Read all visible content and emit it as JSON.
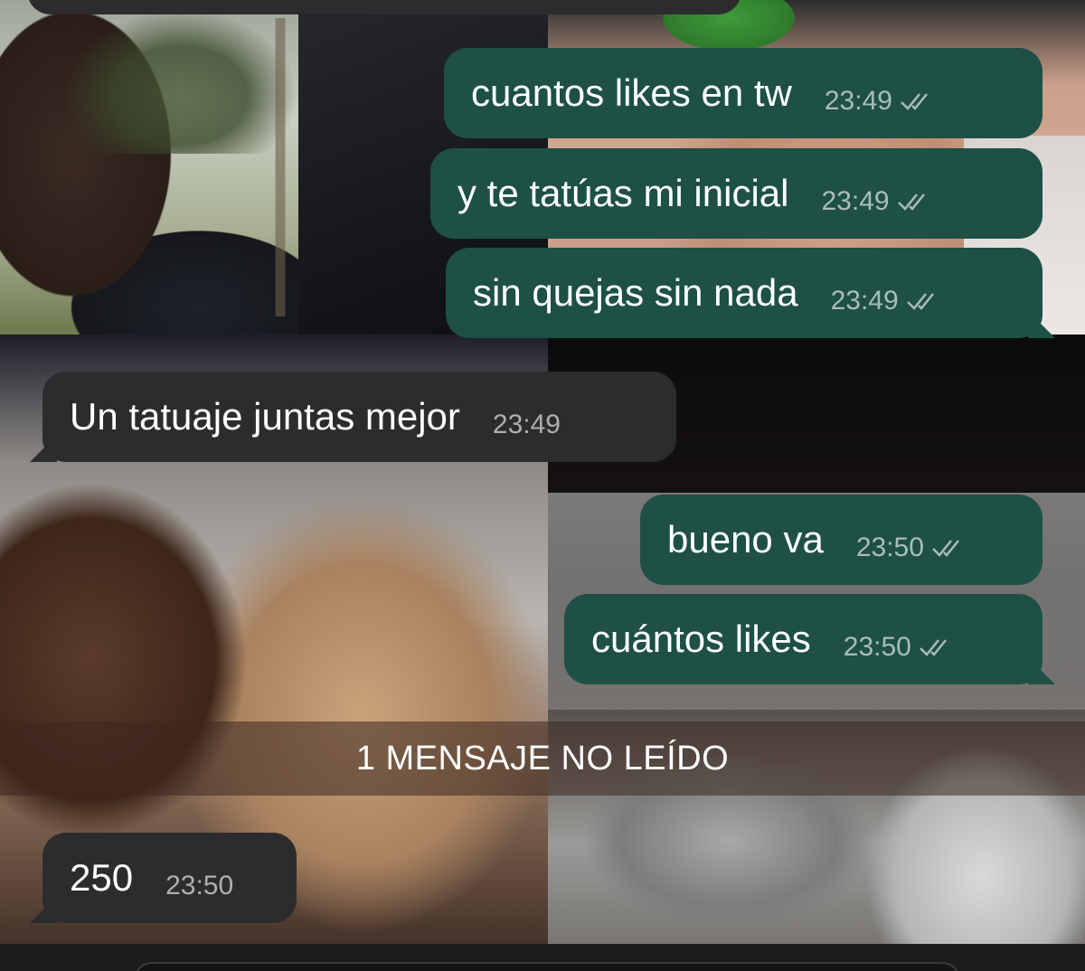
{
  "chat": {
    "messages": [
      {
        "direction": "out",
        "text": "cuantos likes en tw",
        "time": "23:49",
        "status": "read-ticks-icon"
      },
      {
        "direction": "out",
        "text": "y te tatúas mi inicial",
        "time": "23:49",
        "status": "read-ticks-icon"
      },
      {
        "direction": "out",
        "text": "sin quejas sin nada",
        "time": "23:49",
        "status": "read-ticks-icon"
      },
      {
        "direction": "in",
        "text": "Un tatuaje juntas mejor",
        "time": "23:49"
      },
      {
        "direction": "out",
        "text": "bueno va",
        "time": "23:50",
        "status": "read-ticks-icon"
      },
      {
        "direction": "out",
        "text": "cuántos likes",
        "time": "23:50",
        "status": "read-ticks-icon"
      },
      {
        "direction": "in",
        "text": "250",
        "time": "23:50"
      }
    ],
    "unread_divider": "1 MENSAJE NO LEÍDO"
  },
  "colors": {
    "outgoing_bubble": "#1e5045",
    "incoming_bubble": "#2c2c2e",
    "meta_text": "rgba(255,255,255,0.62)"
  }
}
